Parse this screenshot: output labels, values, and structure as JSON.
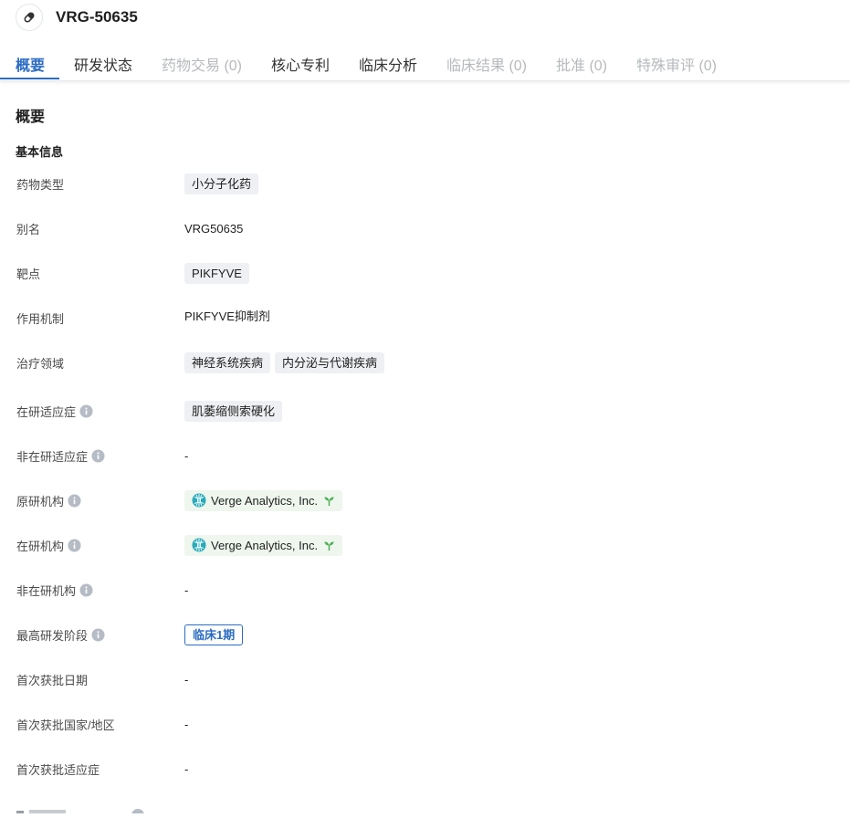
{
  "header": {
    "title": "VRG-50635",
    "icon": "pill-icon"
  },
  "tabs": [
    {
      "label": "概要",
      "state": "active"
    },
    {
      "label": "研发状态",
      "state": "normal"
    },
    {
      "label": "药物交易 (0)",
      "state": "disabled"
    },
    {
      "label": "核心专利",
      "state": "normal"
    },
    {
      "label": "临床分析",
      "state": "normal"
    },
    {
      "label": "临床结果 (0)",
      "state": "disabled"
    },
    {
      "label": "批准 (0)",
      "state": "disabled"
    },
    {
      "label": "特殊审评 (0)",
      "state": "disabled"
    }
  ],
  "overview": {
    "section_title": "概要",
    "basic_info_title": "基本信息",
    "rows": {
      "drug_type": {
        "label": "药物类型",
        "tags": [
          "小分子化药"
        ]
      },
      "alias": {
        "label": "别名",
        "value": "VRG50635"
      },
      "target": {
        "label": "靶点",
        "tags": [
          "PIKFYVE"
        ]
      },
      "mechanism": {
        "label": "作用机制",
        "value": "PIKFYVE抑制剂"
      },
      "therapeutic_area": {
        "label": "治疗领域",
        "tags": [
          "神经系统疾病",
          "内分泌与代谢疾病"
        ]
      },
      "active_indication": {
        "label": "在研适应症",
        "tags": [
          "肌萎缩侧索硬化"
        ]
      },
      "inactive_indication": {
        "label": "非在研适应症",
        "value": "-"
      },
      "originator": {
        "label": "原研机构",
        "org": "Verge Analytics, Inc."
      },
      "active_org": {
        "label": "在研机构",
        "org": "Verge Analytics, Inc."
      },
      "inactive_org": {
        "label": "非在研机构",
        "value": "-"
      },
      "highest_phase": {
        "label": "最高研发阶段",
        "phase": "临床1期"
      },
      "first_approval_date": {
        "label": "首次获批日期",
        "value": "-"
      },
      "first_approval_country": {
        "label": "首次获批国家/地区",
        "value": "-"
      },
      "first_approval_indication": {
        "label": "首次获批适应症",
        "value": "-"
      }
    }
  },
  "colors": {
    "accent": "#2b6cc4",
    "disabled_tab": "#b7b9bd",
    "tag_bg": "#eef0f3",
    "org_bg": "#eef6ee",
    "sprout_green": "#4caf50"
  }
}
